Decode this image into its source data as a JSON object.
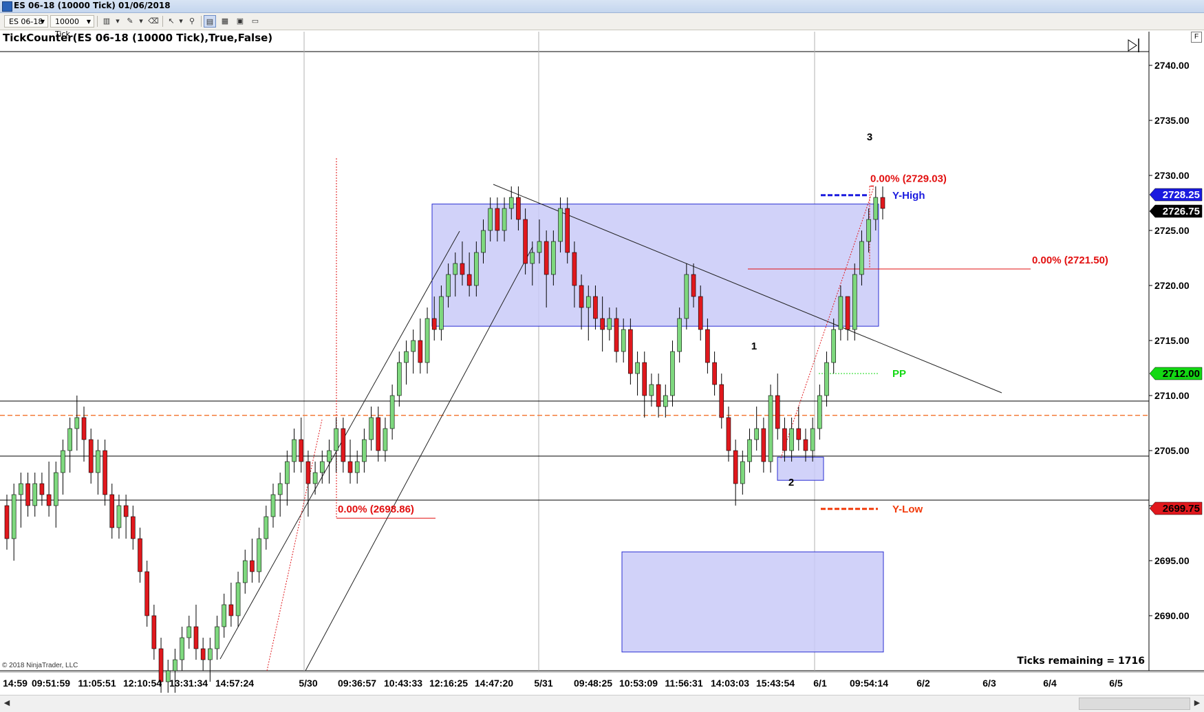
{
  "window": {
    "title": "ES 06-18 (10000 Tick)  01/06/2018"
  },
  "toolbar": {
    "instrument": "ES 06-18",
    "interval": "10000 Tick",
    "icons": [
      "bar-type-icon",
      "drawing-pencil-icon",
      "eraser-icon",
      "pointer-icon",
      "zoom-icon",
      "chart-style-icon",
      "data-box-icon",
      "properties-icon",
      "export-icon"
    ]
  },
  "indicator_label": "TickCounter(ES 06-18 (10000 Tick),True,False)",
  "panel_button": "F",
  "copyright": "© 2018 NinjaTrader, LLC",
  "ticks_remaining": "Ticks remaining = 1716",
  "colors": {
    "up": "#7ed87e",
    "down": "#e0181d",
    "zone": "#c9caf8",
    "zone_border": "#2a2ed2",
    "fib": "#e20f0f",
    "pp": "#13d913"
  },
  "chart_data": {
    "type": "candlestick",
    "symbol": "ES 06-18",
    "ylim": [
      2686.5,
      2742.5
    ],
    "y_ticks": [
      "2740.00",
      "2735.00",
      "2730.00",
      "2725.00",
      "2720.00",
      "2715.00",
      "2710.00",
      "2705.00",
      "2700.00",
      "2695.00",
      "2690.00"
    ],
    "x_ticks": [
      "14:59",
      "09:51:59",
      "11:05:51",
      "12:10:54",
      "13:31:34",
      "14:57:24",
      "5/30",
      "09:36:57",
      "10:43:33",
      "12:16:25",
      "14:47:20",
      "5/31",
      "09:48:25",
      "10:53:09",
      "11:56:31",
      "14:03:03",
      "15:43:54",
      "6/1",
      "09:54:14",
      "6/2",
      "6/3",
      "6/4",
      "6/5"
    ],
    "price_tags": [
      {
        "value": "2728.25",
        "color": "#1a1adf",
        "text_color": "#ffffff"
      },
      {
        "value": "2726.75",
        "color": "#000000",
        "text_color": "#ffffff"
      },
      {
        "value": "2712.00",
        "color": "#13d913",
        "text_color": "#000000"
      },
      {
        "value": "2699.75",
        "color": "#e0181d",
        "text_color": "#000000"
      }
    ],
    "horizontal_levels": [
      2709.5,
      2704.5,
      2700.5
    ],
    "dashed_level": 2708.2,
    "level_labels": [
      {
        "text": "Y-High",
        "value": 2728.2,
        "color": "#1a1adf"
      },
      {
        "text": "PP",
        "value": 2712.0,
        "color": "#13d913"
      },
      {
        "text": "Y-Low",
        "value": 2699.7,
        "color": "#f23a0a"
      }
    ],
    "fib_labels": [
      {
        "text": "0.00% (2729.03)",
        "value": 2729.03
      },
      {
        "text": "0.00% (2721.50)",
        "value": 2721.5
      },
      {
        "text": "0.00% (2698.86)",
        "value": 2698.86
      }
    ],
    "wave_labels": [
      "1",
      "2",
      "3"
    ],
    "zones": [
      {
        "y_top": 2727.4,
        "y_bottom": 2716.3
      },
      {
        "y_top": 2704.4,
        "y_bottom": 2702.3
      },
      {
        "y_top": 2695.8,
        "y_bottom": 2686.7
      }
    ],
    "candles": [
      [
        2700,
        2701,
        2696,
        2697
      ],
      [
        2697,
        2702,
        2695,
        2701
      ],
      [
        2701,
        2703,
        2698,
        2702
      ],
      [
        2702,
        2703,
        2699,
        2700
      ],
      [
        2700,
        2703,
        2699,
        2702
      ],
      [
        2702,
        2703,
        2700,
        2701
      ],
      [
        2701,
        2704,
        2699,
        2700
      ],
      [
        2700,
        2704,
        2698,
        2703
      ],
      [
        2703,
        2706,
        2701,
        2705
      ],
      [
        2705,
        2708,
        2703,
        2707
      ],
      [
        2707,
        2710,
        2705,
        2708
      ],
      [
        2708,
        2709,
        2704,
        2706
      ],
      [
        2706,
        2707,
        2702,
        2703
      ],
      [
        2703,
        2706,
        2701,
        2705
      ],
      [
        2705,
        2706,
        2700,
        2701
      ],
      [
        2701,
        2702,
        2697,
        2698
      ],
      [
        2698,
        2701,
        2697,
        2700
      ],
      [
        2700,
        2701,
        2697,
        2699
      ],
      [
        2699,
        2700,
        2696,
        2697
      ],
      [
        2697,
        2698,
        2693,
        2694
      ],
      [
        2694,
        2695,
        2689,
        2690
      ],
      [
        2690,
        2691,
        2686,
        2687
      ],
      [
        2687,
        2688,
        2683,
        2684
      ],
      [
        2684,
        2686,
        2683,
        2685
      ],
      [
        2685,
        2687,
        2683,
        2686
      ],
      [
        2686,
        2689,
        2685,
        2688
      ],
      [
        2688,
        2690,
        2687,
        2689
      ],
      [
        2689,
        2691,
        2686,
        2687
      ],
      [
        2687,
        2688,
        2685,
        2686
      ],
      [
        2686,
        2688,
        2684,
        2687
      ],
      [
        2687,
        2690,
        2686,
        2689
      ],
      [
        2689,
        2692,
        2688,
        2691
      ],
      [
        2691,
        2693,
        2689,
        2690
      ],
      [
        2690,
        2694,
        2689,
        2693
      ],
      [
        2693,
        2696,
        2692,
        2695
      ],
      [
        2695,
        2697,
        2693,
        2694
      ],
      [
        2694,
        2698,
        2693,
        2697
      ],
      [
        2697,
        2700,
        2696,
        2699
      ],
      [
        2699,
        2702,
        2698,
        2701
      ],
      [
        2701,
        2703,
        2699,
        2702
      ],
      [
        2702,
        2705,
        2700,
        2704
      ],
      [
        2704,
        2707,
        2703,
        2706
      ],
      [
        2706,
        2708,
        2703,
        2704
      ],
      [
        2704,
        2705,
        2699,
        2702
      ],
      [
        2702,
        2704,
        2701,
        2703
      ],
      [
        2703,
        2705,
        2702,
        2704
      ],
      [
        2704,
        2706,
        2702,
        2705
      ],
      [
        2705,
        2708,
        2703,
        2707
      ],
      [
        2707,
        2708,
        2703,
        2704
      ],
      [
        2704,
        2706,
        2702,
        2703
      ],
      [
        2703,
        2705,
        2702,
        2704
      ],
      [
        2704,
        2707,
        2703,
        2706
      ],
      [
        2706,
        2709,
        2705,
        2708
      ],
      [
        2708,
        2709,
        2704,
        2705
      ],
      [
        2705,
        2708,
        2704,
        2707
      ],
      [
        2707,
        2711,
        2706,
        2710
      ],
      [
        2710,
        2714,
        2709,
        2713
      ],
      [
        2713,
        2715,
        2711,
        2714
      ],
      [
        2714,
        2716,
        2712,
        2715
      ],
      [
        2715,
        2717,
        2712,
        2713
      ],
      [
        2713,
        2718,
        2712,
        2717
      ],
      [
        2717,
        2719,
        2715,
        2716
      ],
      [
        2716,
        2720,
        2715,
        2719
      ],
      [
        2719,
        2722,
        2718,
        2721
      ],
      [
        2721,
        2723,
        2719,
        2722
      ],
      [
        2722,
        2724,
        2720,
        2721
      ],
      [
        2721,
        2723,
        2719,
        2720
      ],
      [
        2720,
        2724,
        2719,
        2723
      ],
      [
        2723,
        2726,
        2722,
        2725
      ],
      [
        2725,
        2728,
        2724,
        2727
      ],
      [
        2727,
        2728,
        2724,
        2725
      ],
      [
        2725,
        2728,
        2724,
        2727
      ],
      [
        2727,
        2729,
        2726,
        2728
      ],
      [
        2728,
        2729,
        2725,
        2726
      ],
      [
        2726,
        2727,
        2721,
        2722
      ],
      [
        2722,
        2724,
        2720,
        2723
      ],
      [
        2723,
        2726,
        2722,
        2724
      ],
      [
        2724,
        2725,
        2718,
        2721
      ],
      [
        2721,
        2725,
        2720,
        2724
      ],
      [
        2724,
        2728,
        2723,
        2727
      ],
      [
        2727,
        2728,
        2722,
        2723
      ],
      [
        2723,
        2724,
        2718,
        2720
      ],
      [
        2720,
        2721,
        2716,
        2718
      ],
      [
        2718,
        2720,
        2715,
        2719
      ],
      [
        2719,
        2720,
        2716,
        2717
      ],
      [
        2717,
        2719,
        2714,
        2716
      ],
      [
        2716,
        2718,
        2715,
        2717
      ],
      [
        2717,
        2718,
        2713,
        2714
      ],
      [
        2714,
        2717,
        2713,
        2716
      ],
      [
        2716,
        2717,
        2711,
        2712
      ],
      [
        2712,
        2714,
        2710,
        2713
      ],
      [
        2713,
        2714,
        2708,
        2710
      ],
      [
        2710,
        2712,
        2709,
        2711
      ],
      [
        2711,
        2712,
        2708,
        2709
      ],
      [
        2709,
        2711,
        2708,
        2710
      ],
      [
        2710,
        2715,
        2709,
        2714
      ],
      [
        2714,
        2718,
        2713,
        2717
      ],
      [
        2717,
        2722,
        2716,
        2721
      ],
      [
        2721,
        2722,
        2718,
        2719
      ],
      [
        2719,
        2720,
        2715,
        2716
      ],
      [
        2716,
        2717,
        2712,
        2713
      ],
      [
        2713,
        2714,
        2710,
        2711
      ],
      [
        2711,
        2712,
        2707,
        2708
      ],
      [
        2708,
        2709,
        2704,
        2705
      ],
      [
        2705,
        2706,
        2700,
        2702
      ],
      [
        2702,
        2705,
        2701,
        2704
      ],
      [
        2704,
        2707,
        2703,
        2706
      ],
      [
        2706,
        2709,
        2705,
        2707
      ],
      [
        2707,
        2708,
        2703,
        2704
      ],
      [
        2704,
        2711,
        2703,
        2710
      ],
      [
        2710,
        2712,
        2706,
        2707
      ],
      [
        2707,
        2708,
        2704,
        2705
      ],
      [
        2705,
        2708,
        2704,
        2707
      ],
      [
        2707,
        2709,
        2705,
        2706
      ],
      [
        2706,
        2707,
        2704,
        2705
      ],
      [
        2705,
        2708,
        2704,
        2707
      ],
      [
        2707,
        2711,
        2706,
        2710
      ],
      [
        2710,
        2714,
        2709,
        2713
      ],
      [
        2713,
        2717,
        2712,
        2716
      ],
      [
        2716,
        2720,
        2715,
        2719
      ],
      [
        2719,
        2717,
        2715,
        2716
      ],
      [
        2716,
        2722,
        2715,
        2721
      ],
      [
        2721,
        2725,
        2720,
        2724
      ],
      [
        2724,
        2727,
        2723,
        2726
      ],
      [
        2726,
        2729,
        2725,
        2728
      ],
      [
        2728,
        2729,
        2726,
        2727
      ]
    ]
  }
}
